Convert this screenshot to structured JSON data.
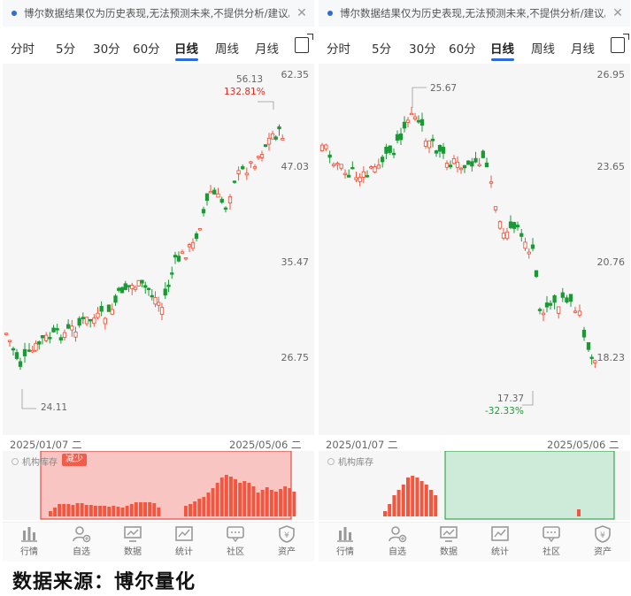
{
  "caption": "数据来源：博尔量化",
  "colors": {
    "up": "#f2563e",
    "down": "#1a9a35",
    "accent": "#2f6bd6",
    "highlight_red": "#f8c5c3",
    "highlight_green": "#cdebd8"
  },
  "nav_items": [
    {
      "label": "行情",
      "icon": "bar-chart-icon"
    },
    {
      "label": "自选",
      "icon": "person-add-icon"
    },
    {
      "label": "数据",
      "icon": "monitor-chart-icon"
    },
    {
      "label": "统计",
      "icon": "line-chart-icon"
    },
    {
      "label": "社区",
      "icon": "chat-bubble-icon"
    },
    {
      "label": "资产",
      "icon": "shield-yen-icon"
    }
  ],
  "panels": [
    {
      "notice": "博尔数据结果仅为历史表现,无法预测未来,不提供分析/建议。",
      "tabs": [
        "分时",
        "5分",
        "30分",
        "60分",
        "日线",
        "周线",
        "月线"
      ],
      "active_tab": "日线",
      "y_labels": [
        "62.35",
        "47.03",
        "35.47",
        "26.75"
      ],
      "high_label": "56.13",
      "high_pct": "132.81%",
      "low_label": "24.11",
      "date_start": "2025/01/07 二",
      "date_end": "2025/05/06 二",
      "sub_label": "机构库存",
      "badge": "减少"
    },
    {
      "notice": "博尔数据结果仅为历史表现,无法预测未来,不提供分析/建议。",
      "tabs": [
        "分时",
        "5分",
        "30分",
        "60分",
        "日线",
        "周线",
        "月线"
      ],
      "active_tab": "日线",
      "y_labels": [
        "26.95",
        "23.65",
        "20.76",
        "18.23"
      ],
      "high_label": "25.67",
      "low_label": "17.37",
      "low_pct": "-32.33%",
      "date_start": "2025/01/07 二",
      "date_end": "2025/05/06 二",
      "sub_label": "机构库存"
    }
  ]
}
